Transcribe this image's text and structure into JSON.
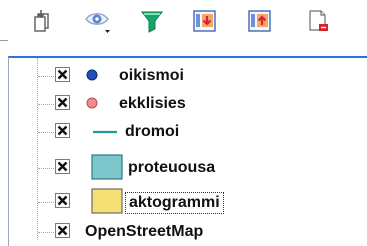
{
  "toolbar": {
    "buttons": [
      {
        "name": "open-layer-styling-icon"
      },
      {
        "name": "manage-map-themes-icon"
      },
      {
        "name": "filter-legend-icon"
      },
      {
        "name": "expand-all-icon"
      },
      {
        "name": "collapse-all-icon"
      },
      {
        "name": "remove-layer-icon"
      }
    ],
    "colors": {
      "filter": "#18a36b",
      "expand": "#f16c2e",
      "remove": "#d81f2a"
    }
  },
  "layers": [
    {
      "label": "oikismoi",
      "symbol": "circle",
      "color": "#1f4fb8",
      "checked": true
    },
    {
      "label": "ekklisies",
      "symbol": "circle",
      "color": "#f08d8d",
      "checked": true
    },
    {
      "label": "dromoi",
      "symbol": "line",
      "color": "#1d9d94",
      "checked": true
    },
    {
      "label": "proteuousa",
      "symbol": "fill",
      "color": "#7cc6cc",
      "checked": true
    },
    {
      "label": "aktogrammi",
      "symbol": "fill",
      "color": "#f6df74",
      "checked": true,
      "selected": true
    },
    {
      "label": "OpenStreetMap",
      "symbol": "none",
      "checked": true
    }
  ]
}
